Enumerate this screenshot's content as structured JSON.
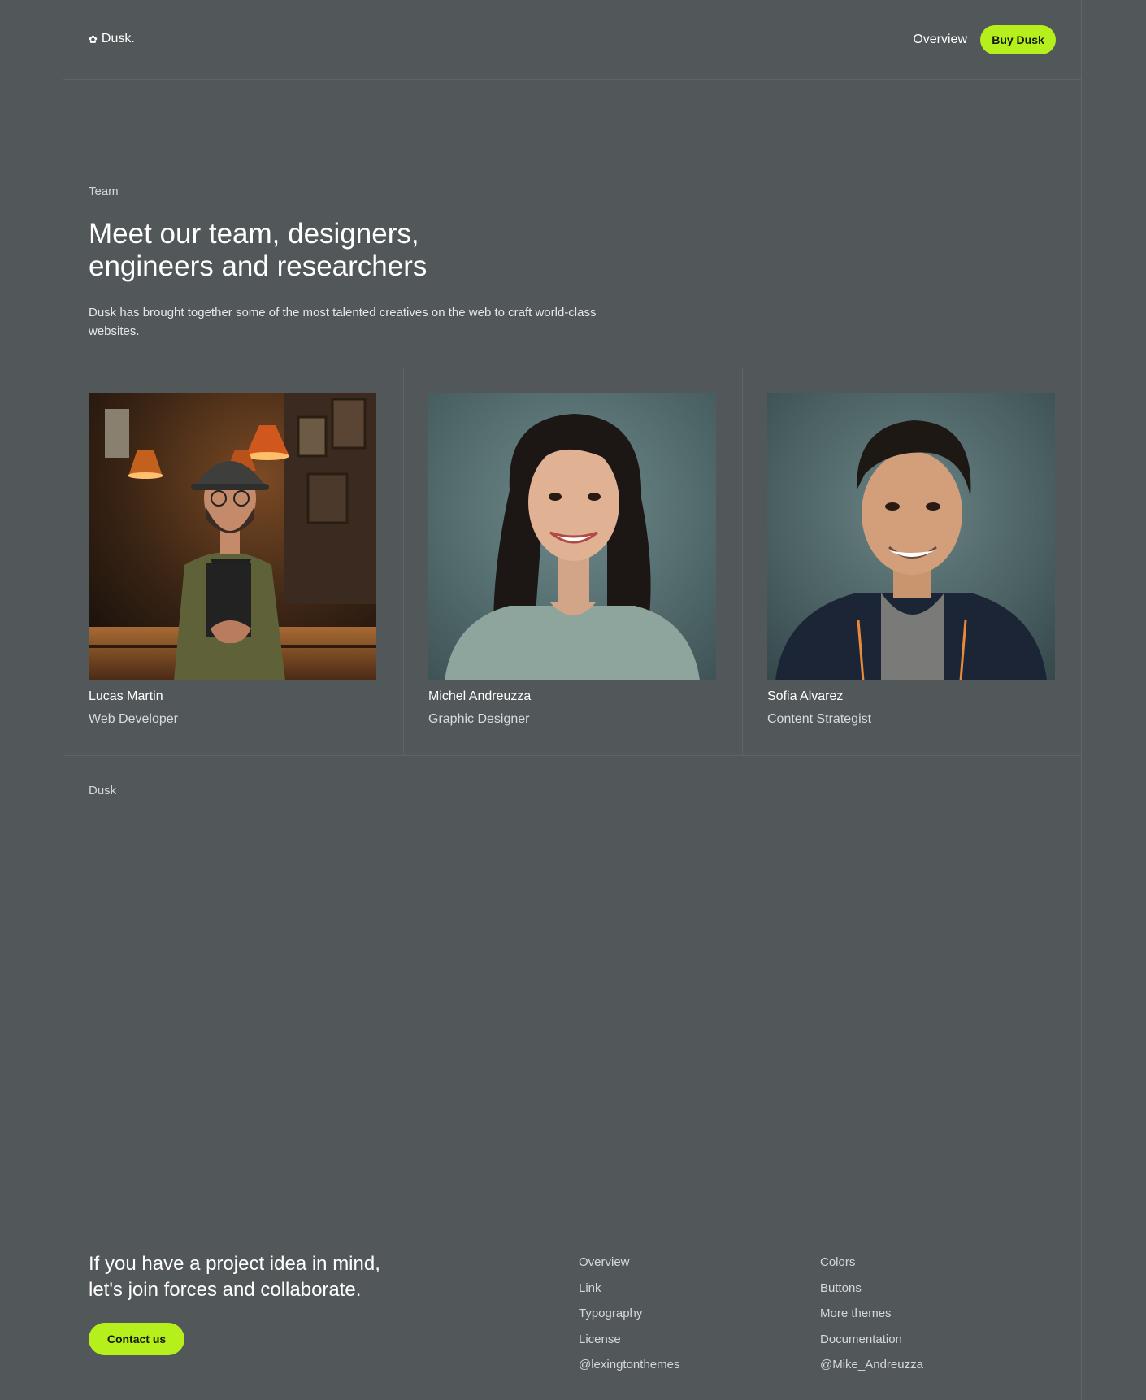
{
  "header": {
    "logo_icon": "✿",
    "logo_text": "Dusk.",
    "nav_overview": "Overview",
    "buy_label": "Buy Dusk"
  },
  "hero": {
    "eyebrow": "Team",
    "title_line1": "Meet our team, designers,",
    "title_line2": "engineers and researchers",
    "description": "Dusk has brought together some of the most talented creatives on the web to craft world-class websites."
  },
  "team": [
    {
      "name": "Lucas Martin",
      "role": "Web Developer",
      "photo": "portrait-man-cap-cafe"
    },
    {
      "name": "Michel Andreuzza",
      "role": "Graphic Designer",
      "photo": "portrait-woman-teal-tshirt"
    },
    {
      "name": "Sofia Alvarez",
      "role": "Content Strategist",
      "photo": "portrait-man-navy-hoodie"
    }
  ],
  "section_label": "Dusk",
  "footer": {
    "cta_line1": "If you have a project idea in mind,",
    "cta_line2": "let's join forces and collaborate.",
    "contact_label": "Contact us",
    "links_col1": [
      "Overview",
      "Link",
      "Typography",
      "License",
      "@lexingtonthemes"
    ],
    "links_col2": [
      "Colors",
      "Buttons",
      "More themes",
      "Documentation",
      "@Mike_Andreuzza"
    ]
  },
  "colors": {
    "background": "#52575a",
    "accent": "#b5f01c",
    "divider": "#5f6467"
  }
}
